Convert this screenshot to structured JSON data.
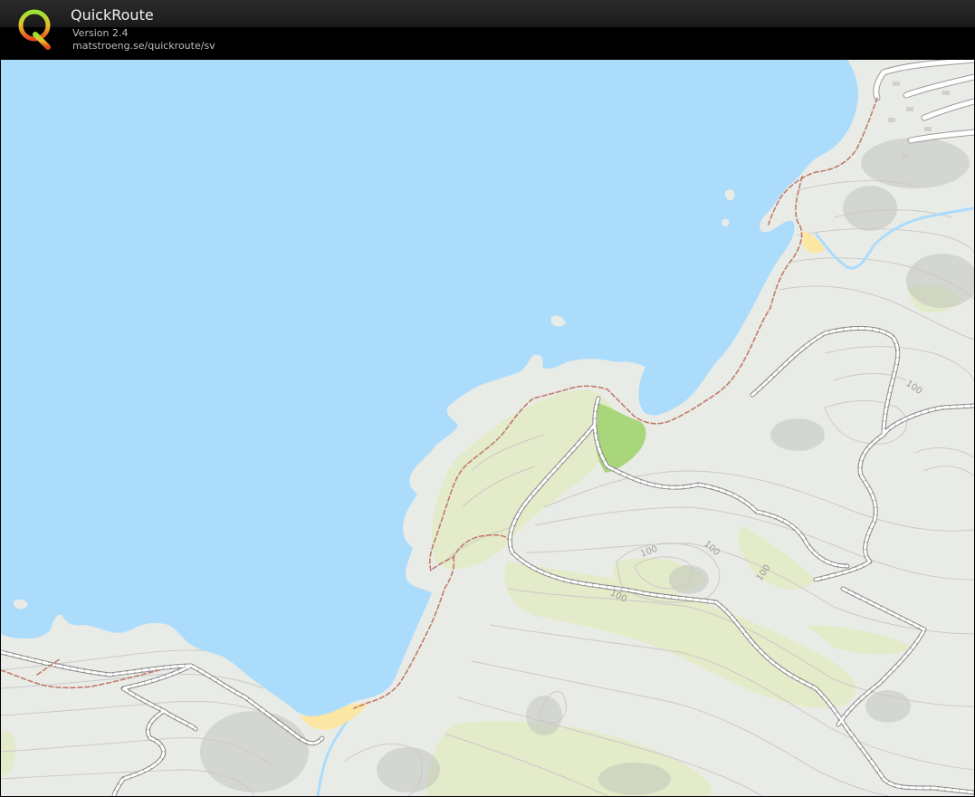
{
  "app": {
    "title": "QuickRoute",
    "version": "Version 2.4",
    "url": "matstroeng.se/quickroute/sv"
  },
  "map": {
    "contour_labels": [
      "100",
      "100",
      "100",
      "100",
      "100"
    ],
    "colors": {
      "water": "#acdcfc",
      "land": "#e9ece6",
      "open_land": "#e3ebc4",
      "meadow": "#a9d67a",
      "beach": "#fbe6a3",
      "path_red": "#c07a6c",
      "road_casing": "#8a8a8a",
      "contour": "#c9c9c9"
    }
  }
}
